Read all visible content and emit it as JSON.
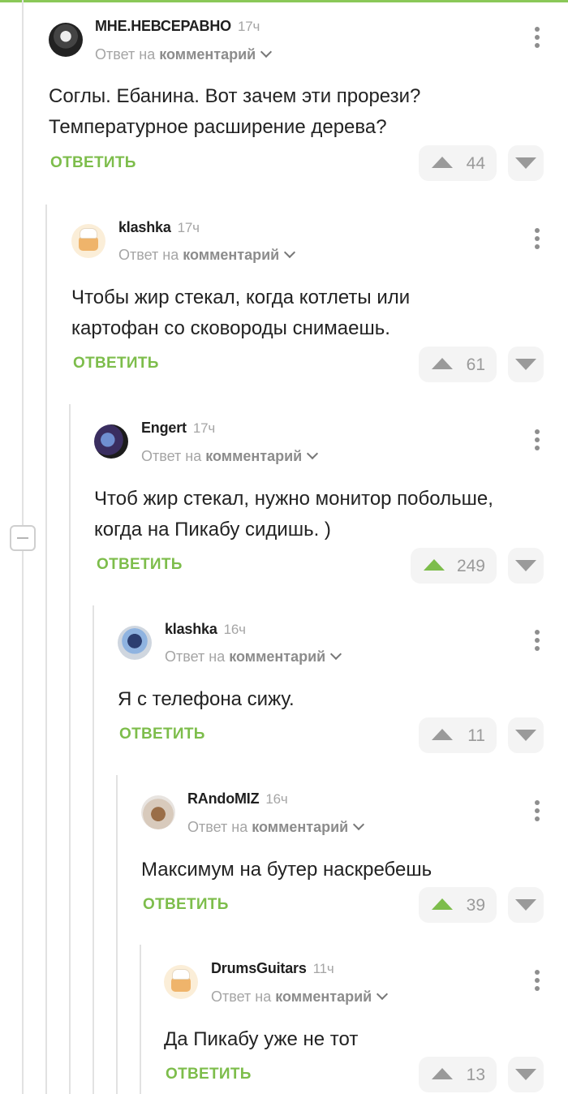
{
  "reply_label": "ОТВЕТИТЬ",
  "accent_color": "#7dbd4b",
  "comments": [
    {
      "author": "МНЕ.НЕВСЕРАВНО",
      "time": "17ч",
      "reply_prefix": "Ответ на",
      "reply_link": "комментарий",
      "text": "Соглы. Ебанина. Вот зачем эти прорези?\nТемпературное расширение дерева?",
      "score": "44",
      "upvoted": false,
      "avatar_icon": "skull-avatar"
    },
    {
      "author": "klashka",
      "time": "17ч",
      "reply_prefix": "Ответ на",
      "reply_link": "комментарий",
      "text": "Чтобы жир стекал, когда котлеты или\nкартофан со сковороды снимаешь.",
      "score": "61",
      "upvoted": false,
      "avatar_icon": "chef-avatar"
    },
    {
      "author": "Engert",
      "time": "17ч",
      "reply_prefix": "Ответ на",
      "reply_link": "комментарий",
      "text": "Чтоб жир стекал, нужно монитор побольше,\nкогда на Пикабу сидишь. )",
      "score": "249",
      "upvoted": true,
      "avatar_icon": "engert-avatar"
    },
    {
      "author": "klashka",
      "time": "16ч",
      "reply_prefix": "Ответ на",
      "reply_link": "комментарий",
      "text": "Я с телефона сижу.",
      "score": "11",
      "upvoted": false,
      "avatar_icon": "robot-avatar"
    },
    {
      "author": "RAndoMIZ",
      "time": "16ч",
      "reply_prefix": "Ответ на",
      "reply_link": "комментарий",
      "text": "Максимум на бутер наскребешь",
      "score": "39",
      "upvoted": true,
      "avatar_icon": "doll-avatar"
    },
    {
      "author": "DrumsGuitars",
      "time": "11ч",
      "reply_prefix": "Ответ на",
      "reply_link": "комментарий",
      "text": "Да Пикабу уже не тот",
      "score": "13",
      "upvoted": false,
      "avatar_icon": "chef-avatar"
    }
  ]
}
